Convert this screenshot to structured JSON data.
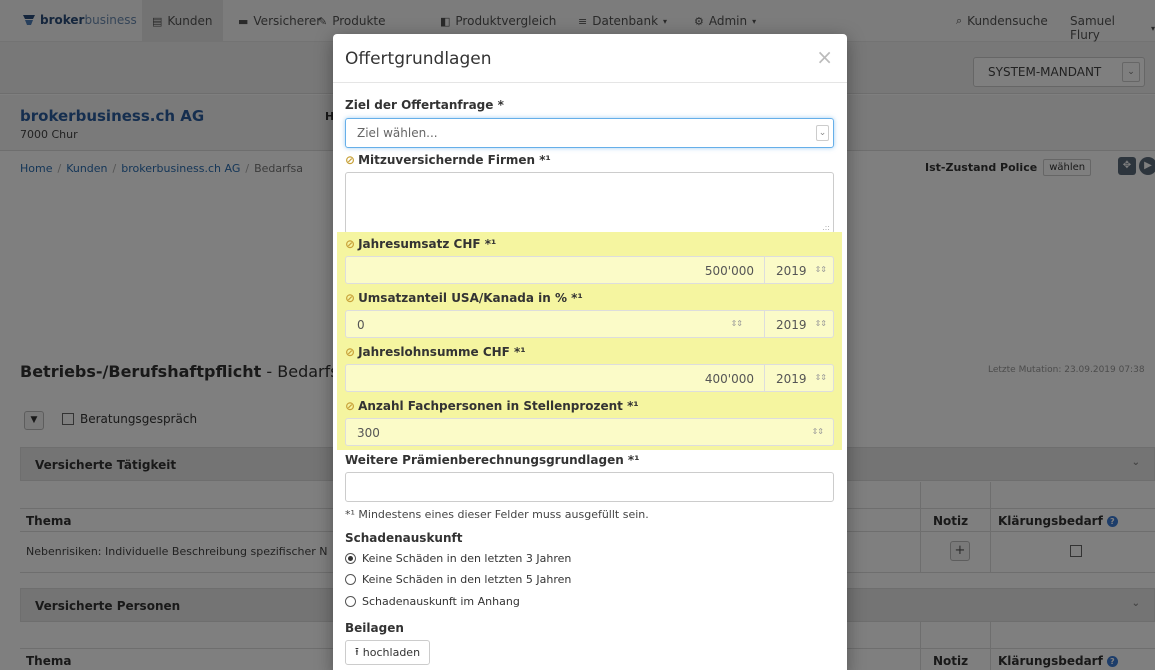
{
  "navbar": {
    "brand_bold": "broker",
    "brand_rest": "business",
    "items": [
      {
        "label": "Kunden",
        "icon": "id-card-icon"
      },
      {
        "label": "Versicherer",
        "icon": "briefcase-icon"
      },
      {
        "label": "Produkte",
        "icon": "pen-icon"
      },
      {
        "label": "Produktvergleich",
        "icon": "compare-icon"
      },
      {
        "label": "Datenbank",
        "icon": "database-icon"
      },
      {
        "label": "Admin",
        "icon": "gears-icon"
      }
    ],
    "search_label": "Kundensuche",
    "user": "Samuel Flury"
  },
  "mandant_select": "SYSTEM-MANDANT",
  "company": {
    "name": "brokerbusiness.ch AG",
    "city": "7000 Chur",
    "header_fragment": "H"
  },
  "breadcrumb": {
    "home": "Home",
    "kunden": "Kunden",
    "company": "brokerbusiness.ch AG",
    "current": "Bedarfsa"
  },
  "ist_zustand": {
    "label": "Ist-Zustand Police",
    "button": "wählen"
  },
  "page_title": {
    "bold": "Betriebs-/Berufshaftpflicht",
    "rest": " - Bedarfsar"
  },
  "last_mutation": "Letzte Mutation: 23.09.2019 07:38",
  "beratung_label": "Beratungsgespräch",
  "panel1": {
    "title": "Versicherte Tätigkeit",
    "col_thema": "Thema",
    "col_notiz": "Notiz",
    "col_klaerung": "Klärungsbedarf",
    "row_text": "Nebenrisiken: Individuelle Beschreibung spezifischer N"
  },
  "panel2": {
    "title": "Versicherte Personen",
    "col_thema": "Thema",
    "col_notiz": "Notiz",
    "col_klaerung": "Klärungsbedarf"
  },
  "modal": {
    "title": "Offertgrundlagen",
    "close": "×",
    "ziel_label": "Ziel der Offertanfrage *",
    "ziel_placeholder": "Ziel wählen...",
    "mitver_label": "Mitzuversichernde Firmen *¹",
    "jahresumsatz_label": "Jahresumsatz CHF *¹",
    "jahresumsatz_value": "500'000",
    "jahresumsatz_year": "2019",
    "usa_label": "Umsatzanteil USA/Kanada in % *¹",
    "usa_value": "0",
    "usa_year": "2019",
    "lohn_label": "Jahreslohnsumme CHF *¹",
    "lohn_value": "400'000",
    "lohn_year": "2019",
    "fach_label": "Anzahl Fachpersonen in Stellenprozent *¹",
    "fach_value": "300",
    "weitere_label": "Weitere Prämienberechnungsgrundlagen *¹",
    "footnote": "*¹ Mindestens eines dieser Felder muss ausgefüllt sein.",
    "schaden_label": "Schadenauskunft",
    "schaden_options": [
      "Keine Schäden in den letzten 3 Jahren",
      "Keine Schäden in den letzten 5 Jahren",
      "Schadenauskunft im Anhang"
    ],
    "schaden_selected": 0,
    "beilagen_label": "Beilagen",
    "upload_button": "hochladen"
  },
  "colors": {
    "highlight": "#f5f5a0",
    "brand": "#2a5d9f",
    "accent_focus": "#66afe9"
  }
}
